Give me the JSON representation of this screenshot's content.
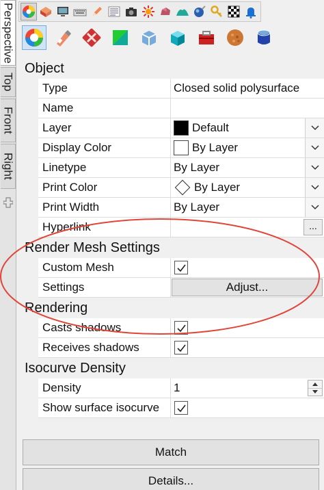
{
  "viewport_tabs": [
    {
      "label": "Perspective",
      "active": true
    },
    {
      "label": "Top",
      "active": false
    },
    {
      "label": "Front",
      "active": false
    },
    {
      "label": "Right",
      "active": false
    }
  ],
  "add_tab_icon": "plus-icon",
  "toolbar_row1_icons": [
    "color-wheel-icon",
    "material-icon",
    "display-icon",
    "keyboard-icon",
    "pencil-icon",
    "text-grid-icon",
    "camera-icon",
    "sun-burst-icon",
    "rock-icon",
    "terrain-icon",
    "sphere-tool-icon",
    "key-icon",
    "checker-icon",
    "bell-icon"
  ],
  "toolbar_row2_icons": [
    "color-wheel-icon",
    "spray-can-icon",
    "decal-icon",
    "texture-icon",
    "box-mapping-icon",
    "cube-icon",
    "toolbox-icon",
    "sphere-texture-icon",
    "database-icon"
  ],
  "sections": {
    "object": {
      "title": "Object",
      "rows": {
        "type": {
          "label": "Type",
          "value": "Closed solid polysurface"
        },
        "name": {
          "label": "Name",
          "value": ""
        },
        "layer": {
          "label": "Layer",
          "value": "Default"
        },
        "display_color": {
          "label": "Display Color",
          "value": "By Layer"
        },
        "linetype": {
          "label": "Linetype",
          "value": "By Layer"
        },
        "print_color": {
          "label": "Print Color",
          "value": "By Layer"
        },
        "print_width": {
          "label": "Print Width",
          "value": "By Layer"
        },
        "hyperlink": {
          "label": "Hyperlink",
          "value": "",
          "button": "..."
        }
      }
    },
    "render_mesh": {
      "title": "Render Mesh Settings",
      "rows": {
        "custom_mesh": {
          "label": "Custom Mesh",
          "checked": true
        },
        "settings": {
          "label": "Settings",
          "button": "Adjust..."
        }
      }
    },
    "rendering": {
      "title": "Rendering",
      "rows": {
        "casts_shadows": {
          "label": "Casts shadows",
          "checked": true
        },
        "receives_shadows": {
          "label": "Receives shadows",
          "checked": true
        }
      }
    },
    "isocurve": {
      "title": "Isocurve Density",
      "rows": {
        "density": {
          "label": "Density",
          "value": "1"
        },
        "show_surface_isocurve": {
          "label": "Show surface isocurve",
          "checked": true
        }
      }
    }
  },
  "buttons": {
    "match": "Match",
    "details": "Details..."
  },
  "colors": {
    "annotation_ellipse": "#e0453a",
    "layer_swatch": "#000000",
    "display_swatch": "#ffffff"
  }
}
